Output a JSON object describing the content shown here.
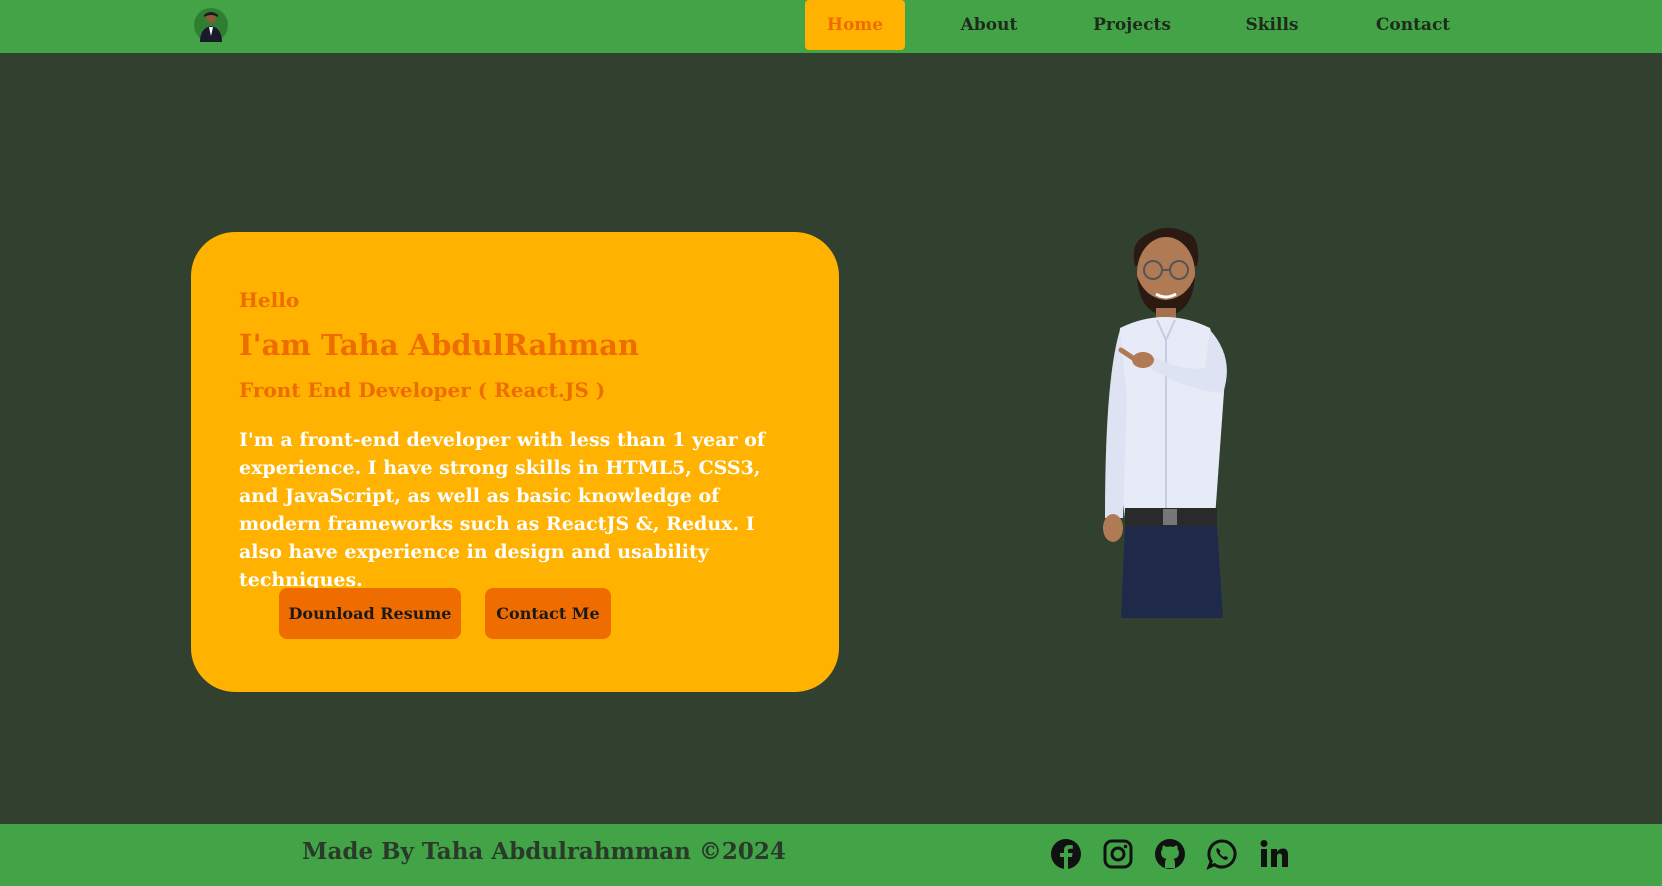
{
  "nav": {
    "items": [
      {
        "label": "Home",
        "active": true
      },
      {
        "label": "About",
        "active": false
      },
      {
        "label": "Projects",
        "active": false
      },
      {
        "label": "Skills",
        "active": false
      },
      {
        "label": "Contact",
        "active": false
      }
    ]
  },
  "hero": {
    "greeting": "Hello",
    "name": "I'am Taha AbdulRahman",
    "role": "Front End Developer ( React.JS )",
    "bio": "I'm a front-end developer with less than 1 year of experience. I have strong skills in HTML5, CSS3, and JavaScript, as well as basic knowledge of modern frameworks such as ReactJS &, Redux. I also have experience in design and usability techniques.",
    "download_label": "Dounload Resume",
    "contact_label": "Contact Me"
  },
  "footer": {
    "text": "Made By Taha Abdulrahmman ©2024",
    "socials": [
      "facebook-icon",
      "instagram-icon",
      "github-icon",
      "whatsapp-icon",
      "linkedin-icon"
    ]
  },
  "colors": {
    "topbar": "#43a347",
    "background": "#32402f",
    "accent": "#ffb300",
    "orange": "#ef6c00"
  }
}
